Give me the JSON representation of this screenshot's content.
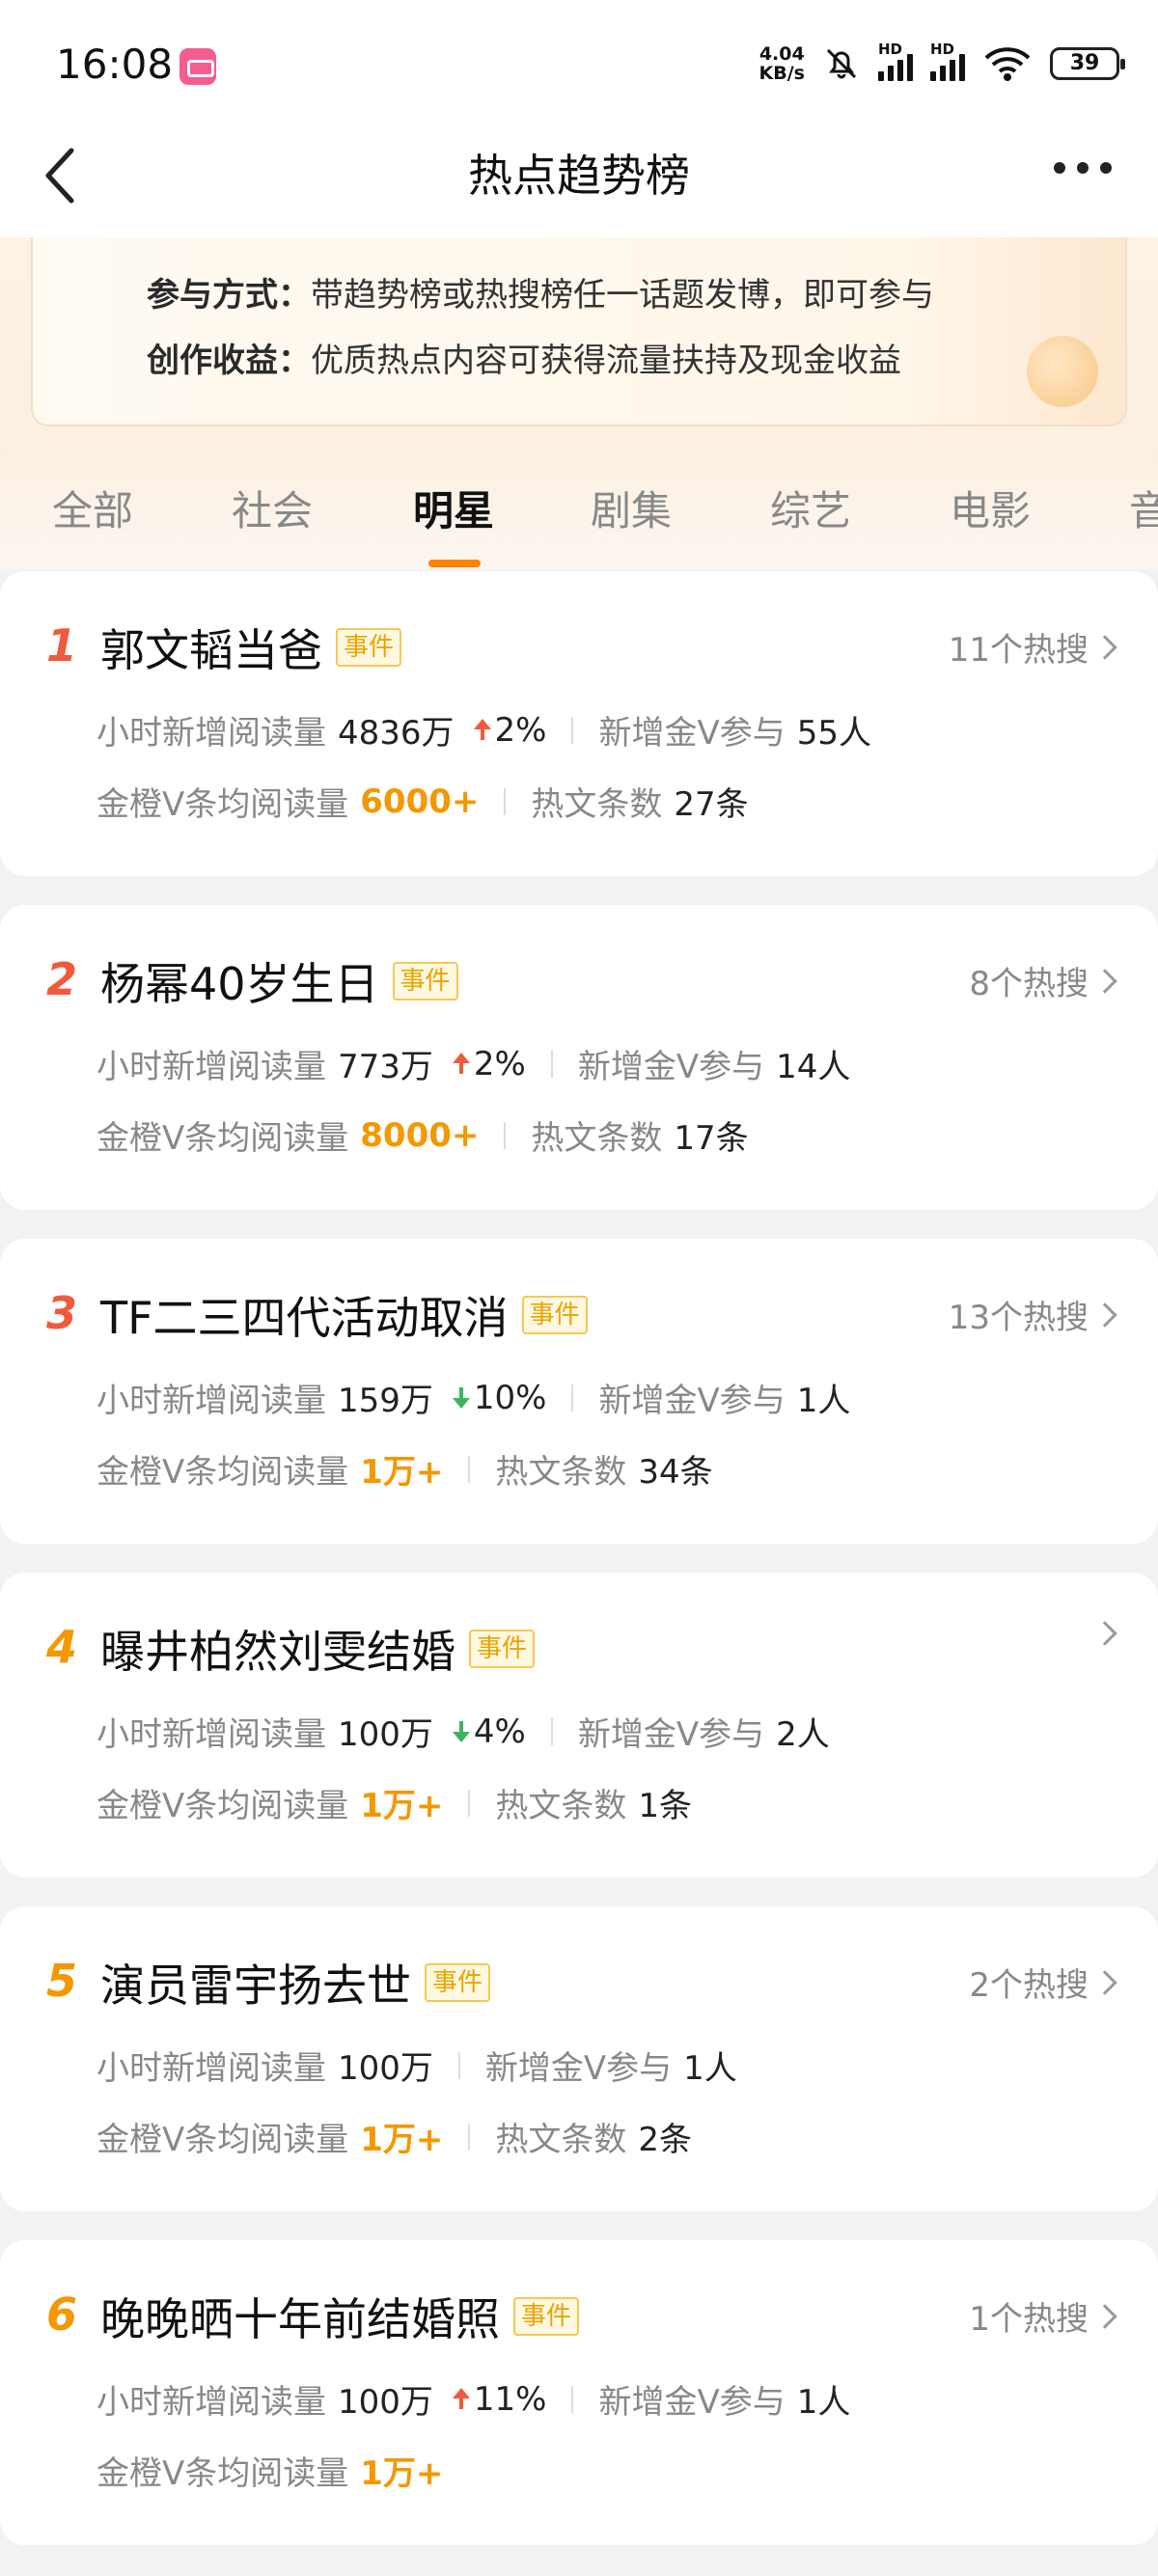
{
  "status": {
    "time": "16:08",
    "net_speed_top": "4.04",
    "net_speed_bottom": "KB/s",
    "hd": "HD",
    "battery": "39"
  },
  "nav": {
    "title": "热点趋势榜"
  },
  "banner": {
    "row1_key": "参与方式：",
    "row1_val": "带趋势榜或热搜榜任一话题发博，即可参与",
    "row2_key": "创作收益：",
    "row2_val": "优质热点内容可获得流量扶持及现金收益"
  },
  "tabs": [
    "全部",
    "社会",
    "明星",
    "剧集",
    "综艺",
    "电影",
    "音"
  ],
  "labels": {
    "hourly_reads": "小时新增阅读量",
    "gold_v_join": "新增金V参与",
    "avg_reads": "金橙V条均阅读量",
    "hot_posts": "热文条数",
    "tag": "事件"
  },
  "items": [
    {
      "rank": "1",
      "title": "郭文韬当爸",
      "hot": "11个热搜",
      "reads": "4836万",
      "trend": "2%",
      "gold": "55人",
      "avg": "6000+",
      "posts": "27条"
    },
    {
      "rank": "2",
      "title": "杨幂40岁生日",
      "hot": "8个热搜",
      "reads": "773万",
      "trend": "2%",
      "gold": "14人",
      "avg": "8000+",
      "posts": "17条"
    },
    {
      "rank": "3",
      "title": "TF二三四代活动取消",
      "hot": "13个热搜",
      "reads": "159万",
      "trend": "10%",
      "gold": "1人",
      "avg": "1万+",
      "posts": "34条"
    },
    {
      "rank": "4",
      "title": "曝井柏然刘雯结婚",
      "hot": "",
      "reads": "100万",
      "trend": "4%",
      "gold": "2人",
      "avg": "1万+",
      "posts": "1条"
    },
    {
      "rank": "5",
      "title": "演员雷宇扬去世",
      "hot": "2个热搜",
      "reads": "100万",
      "trend": "",
      "gold": "1人",
      "avg": "1万+",
      "posts": "2条"
    },
    {
      "rank": "6",
      "title": "晚晚晒十年前结婚照",
      "hot": "1个热搜",
      "reads": "100万",
      "trend": "11%",
      "gold": "1人",
      "avg": "1万+",
      "posts": ""
    }
  ],
  "colors": {
    "rank_top": "#f05a3c",
    "rank_other": "#f39800",
    "accent": "#ff8200",
    "up": "#f05a3c",
    "down": "#3cb55e"
  }
}
